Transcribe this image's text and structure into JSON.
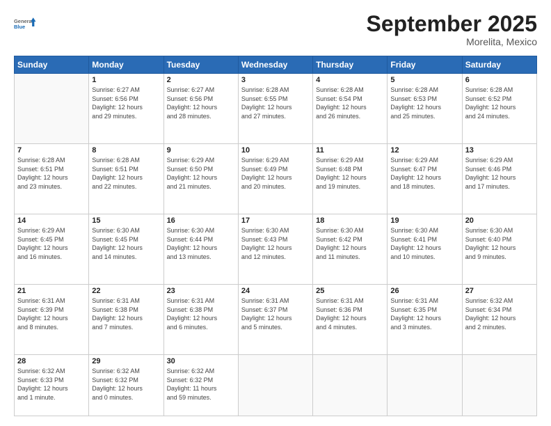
{
  "logo": {
    "general": "General",
    "blue": "Blue"
  },
  "header": {
    "month": "September 2025",
    "location": "Morelita, Mexico"
  },
  "weekdays": [
    "Sunday",
    "Monday",
    "Tuesday",
    "Wednesday",
    "Thursday",
    "Friday",
    "Saturday"
  ],
  "weeks": [
    [
      {
        "day": "",
        "info": ""
      },
      {
        "day": "1",
        "info": "Sunrise: 6:27 AM\nSunset: 6:56 PM\nDaylight: 12 hours\nand 29 minutes."
      },
      {
        "day": "2",
        "info": "Sunrise: 6:27 AM\nSunset: 6:56 PM\nDaylight: 12 hours\nand 28 minutes."
      },
      {
        "day": "3",
        "info": "Sunrise: 6:28 AM\nSunset: 6:55 PM\nDaylight: 12 hours\nand 27 minutes."
      },
      {
        "day": "4",
        "info": "Sunrise: 6:28 AM\nSunset: 6:54 PM\nDaylight: 12 hours\nand 26 minutes."
      },
      {
        "day": "5",
        "info": "Sunrise: 6:28 AM\nSunset: 6:53 PM\nDaylight: 12 hours\nand 25 minutes."
      },
      {
        "day": "6",
        "info": "Sunrise: 6:28 AM\nSunset: 6:52 PM\nDaylight: 12 hours\nand 24 minutes."
      }
    ],
    [
      {
        "day": "7",
        "info": "Sunrise: 6:28 AM\nSunset: 6:51 PM\nDaylight: 12 hours\nand 23 minutes."
      },
      {
        "day": "8",
        "info": "Sunrise: 6:28 AM\nSunset: 6:51 PM\nDaylight: 12 hours\nand 22 minutes."
      },
      {
        "day": "9",
        "info": "Sunrise: 6:29 AM\nSunset: 6:50 PM\nDaylight: 12 hours\nand 21 minutes."
      },
      {
        "day": "10",
        "info": "Sunrise: 6:29 AM\nSunset: 6:49 PM\nDaylight: 12 hours\nand 20 minutes."
      },
      {
        "day": "11",
        "info": "Sunrise: 6:29 AM\nSunset: 6:48 PM\nDaylight: 12 hours\nand 19 minutes."
      },
      {
        "day": "12",
        "info": "Sunrise: 6:29 AM\nSunset: 6:47 PM\nDaylight: 12 hours\nand 18 minutes."
      },
      {
        "day": "13",
        "info": "Sunrise: 6:29 AM\nSunset: 6:46 PM\nDaylight: 12 hours\nand 17 minutes."
      }
    ],
    [
      {
        "day": "14",
        "info": "Sunrise: 6:29 AM\nSunset: 6:45 PM\nDaylight: 12 hours\nand 16 minutes."
      },
      {
        "day": "15",
        "info": "Sunrise: 6:30 AM\nSunset: 6:45 PM\nDaylight: 12 hours\nand 14 minutes."
      },
      {
        "day": "16",
        "info": "Sunrise: 6:30 AM\nSunset: 6:44 PM\nDaylight: 12 hours\nand 13 minutes."
      },
      {
        "day": "17",
        "info": "Sunrise: 6:30 AM\nSunset: 6:43 PM\nDaylight: 12 hours\nand 12 minutes."
      },
      {
        "day": "18",
        "info": "Sunrise: 6:30 AM\nSunset: 6:42 PM\nDaylight: 12 hours\nand 11 minutes."
      },
      {
        "day": "19",
        "info": "Sunrise: 6:30 AM\nSunset: 6:41 PM\nDaylight: 12 hours\nand 10 minutes."
      },
      {
        "day": "20",
        "info": "Sunrise: 6:30 AM\nSunset: 6:40 PM\nDaylight: 12 hours\nand 9 minutes."
      }
    ],
    [
      {
        "day": "21",
        "info": "Sunrise: 6:31 AM\nSunset: 6:39 PM\nDaylight: 12 hours\nand 8 minutes."
      },
      {
        "day": "22",
        "info": "Sunrise: 6:31 AM\nSunset: 6:38 PM\nDaylight: 12 hours\nand 7 minutes."
      },
      {
        "day": "23",
        "info": "Sunrise: 6:31 AM\nSunset: 6:38 PM\nDaylight: 12 hours\nand 6 minutes."
      },
      {
        "day": "24",
        "info": "Sunrise: 6:31 AM\nSunset: 6:37 PM\nDaylight: 12 hours\nand 5 minutes."
      },
      {
        "day": "25",
        "info": "Sunrise: 6:31 AM\nSunset: 6:36 PM\nDaylight: 12 hours\nand 4 minutes."
      },
      {
        "day": "26",
        "info": "Sunrise: 6:31 AM\nSunset: 6:35 PM\nDaylight: 12 hours\nand 3 minutes."
      },
      {
        "day": "27",
        "info": "Sunrise: 6:32 AM\nSunset: 6:34 PM\nDaylight: 12 hours\nand 2 minutes."
      }
    ],
    [
      {
        "day": "28",
        "info": "Sunrise: 6:32 AM\nSunset: 6:33 PM\nDaylight: 12 hours\nand 1 minute."
      },
      {
        "day": "29",
        "info": "Sunrise: 6:32 AM\nSunset: 6:32 PM\nDaylight: 12 hours\nand 0 minutes."
      },
      {
        "day": "30",
        "info": "Sunrise: 6:32 AM\nSunset: 6:32 PM\nDaylight: 11 hours\nand 59 minutes."
      },
      {
        "day": "",
        "info": ""
      },
      {
        "day": "",
        "info": ""
      },
      {
        "day": "",
        "info": ""
      },
      {
        "day": "",
        "info": ""
      }
    ]
  ]
}
